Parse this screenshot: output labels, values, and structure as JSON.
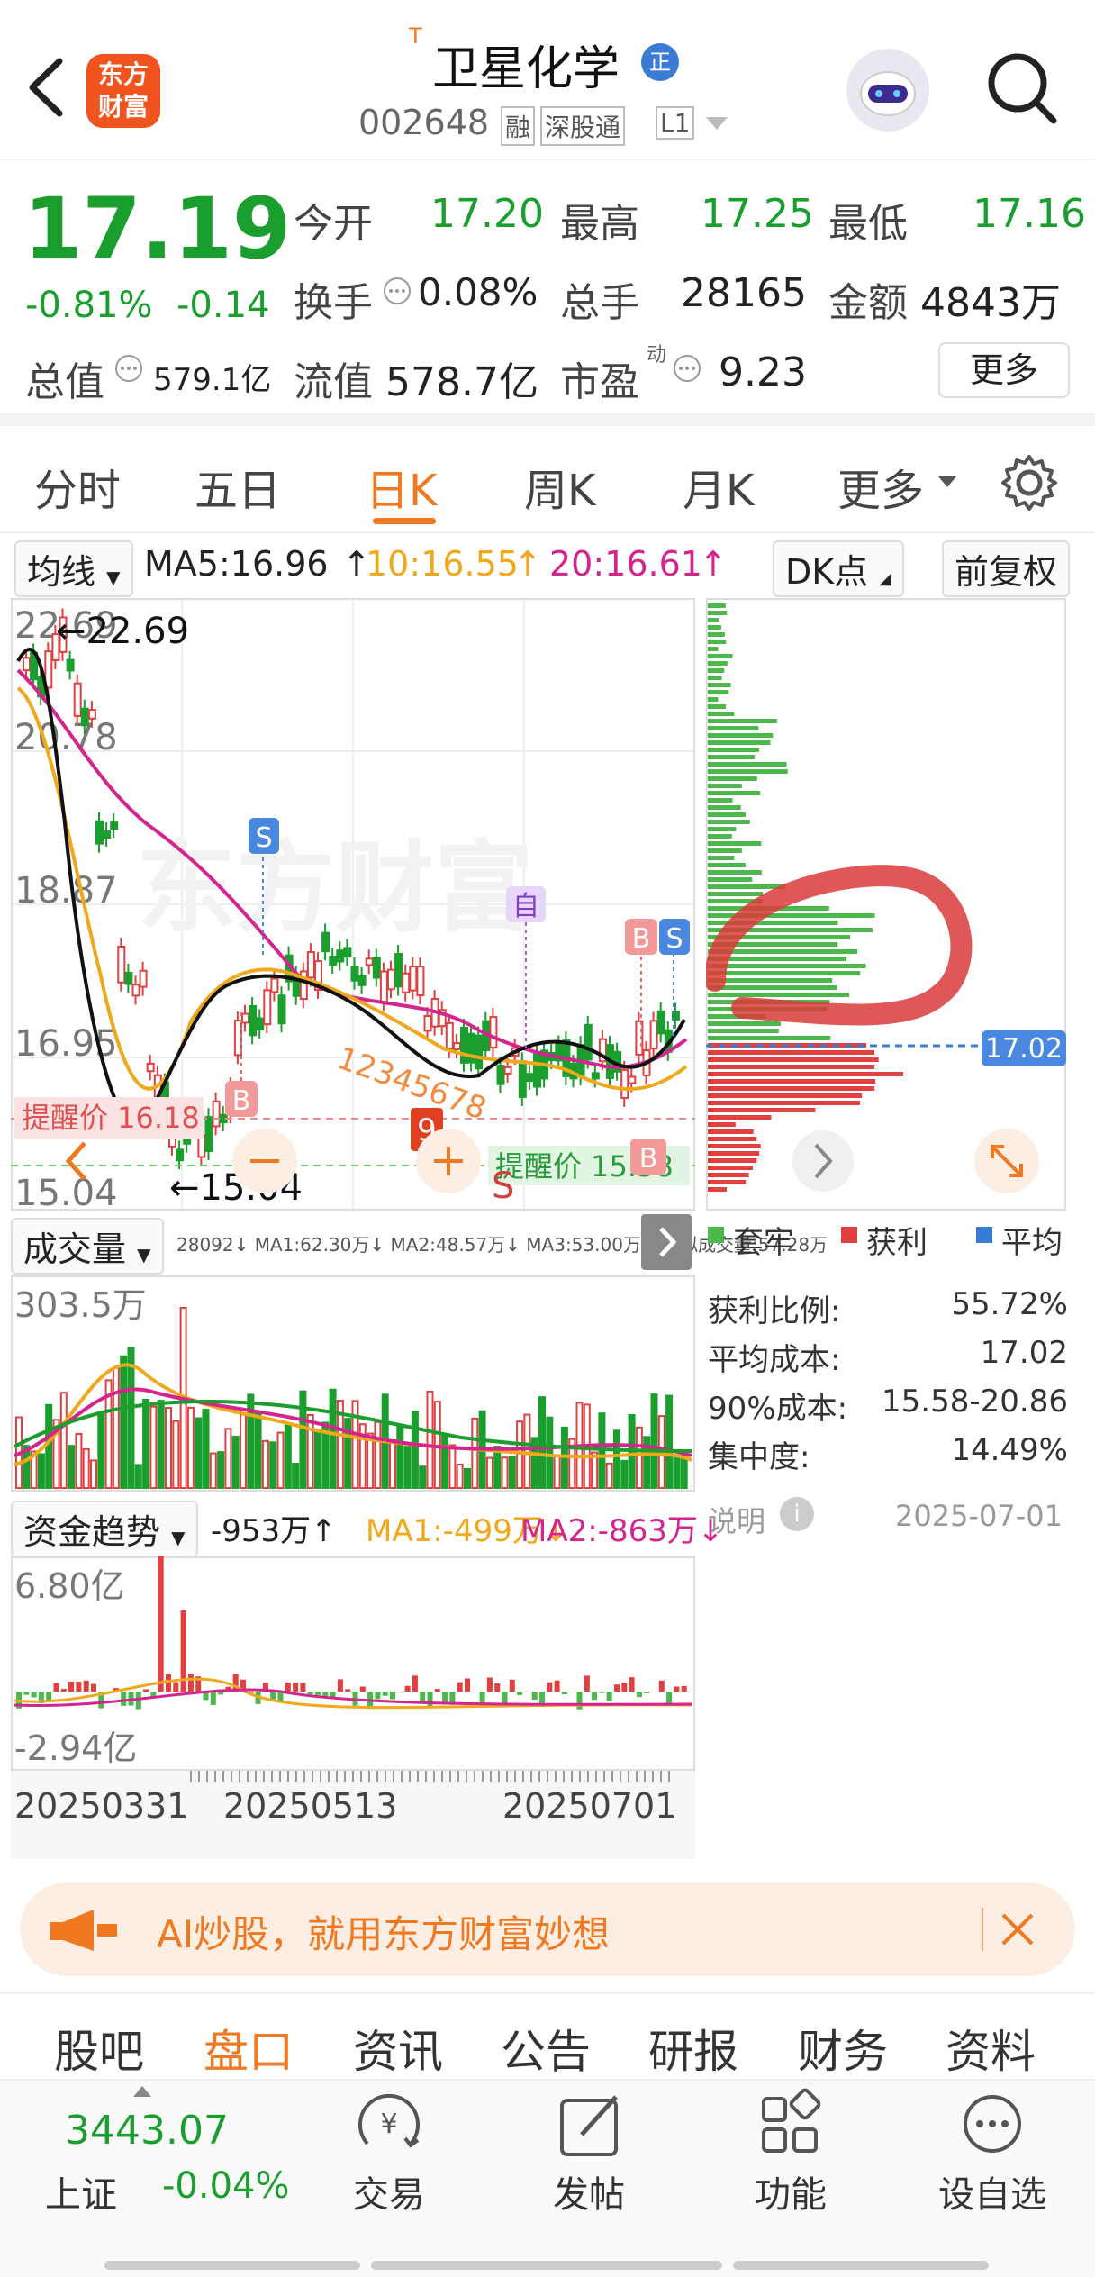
{
  "header": {
    "title": "卫星化学",
    "title_prefix": "T",
    "badge": "正",
    "code": "002648",
    "tags": [
      "融",
      "深股通",
      "L1"
    ],
    "logo": "东方财富"
  },
  "quote": {
    "price": "17.19",
    "change_pct": "-0.81%",
    "change": "-0.14",
    "fields": [
      {
        "label": "今开",
        "value": "17.20"
      },
      {
        "label": "最高",
        "value": "17.25"
      },
      {
        "label": "最低",
        "value": "17.16"
      },
      {
        "label": "换手",
        "value": "0.08%"
      },
      {
        "label": "总手",
        "value": "28165"
      },
      {
        "label": "金额",
        "value": "4843万"
      },
      {
        "label": "总值",
        "value": "579.1亿"
      },
      {
        "label": "流值",
        "value": "578.7亿"
      },
      {
        "label": "市盈",
        "value": "9.23",
        "sup": "动"
      }
    ],
    "more": "更多"
  },
  "tabs": [
    "分时",
    "五日",
    "日K",
    "周K",
    "月K",
    "更多"
  ],
  "active_tab": "日K",
  "ma_bar": {
    "selector": "均线",
    "ma5": "MA5:16.96",
    "ma10": "10:16.55",
    "ma20": "20:16.61",
    "dk": "DK点",
    "adjust": "前复权",
    "colors": {
      "ma5": "#222222",
      "ma10": "#f0a81c",
      "ma20": "#d4258f"
    }
  },
  "kline": {
    "y_labels": [
      "22.69",
      "20.78",
      "18.87",
      "16.95",
      "15.04"
    ],
    "high_mark": "22.69",
    "low_mark": "15.04",
    "alert_upper": "提醒价 16.18",
    "alert_lower": "提醒价 15.58",
    "watermark": "东方财富",
    "signals": [
      "S",
      "B",
      "自",
      "B",
      "S",
      "B",
      "S"
    ],
    "sequence": "12345678",
    "sequence_end": "9"
  },
  "chart_data": {
    "type": "line",
    "title": "",
    "categories": [
      "20250331",
      "20250513",
      "20250701"
    ],
    "series": [
      {
        "name": "MA5",
        "values": [
          16.96
        ]
      },
      {
        "name": "MA10",
        "values": [
          16.55
        ]
      },
      {
        "name": "MA20",
        "values": [
          16.61
        ]
      }
    ],
    "ylim": [
      15.04,
      22.69
    ],
    "yticks": [
      22.69,
      20.78,
      18.87,
      16.95,
      15.04
    ]
  },
  "volume": {
    "selector": "成交量",
    "info": "28092↓ MA1:62.30万↓ MA2:48.57万↓ MA3:53.00万↓ 虚拟成交量:57.28万",
    "max_label": "303.5万"
  },
  "fund": {
    "selector": "资金趋势",
    "value": "-953万↑",
    "ma1": "MA1:-499万↓",
    "ma2": "MA2:-863万↓",
    "max_label": "6.80亿",
    "min_label": "-2.94亿",
    "dates": [
      "20250331",
      "20250513",
      "20250701"
    ]
  },
  "chips": {
    "avg_tag": "17.02",
    "legend": [
      "套牢",
      "获利",
      "平均"
    ],
    "legend_colors": [
      "#4cb84c",
      "#e04040",
      "#3a7bd5"
    ],
    "rows": [
      {
        "label": "获利比例:",
        "value": "55.72%"
      },
      {
        "label": "平均成本:",
        "value": "17.02"
      },
      {
        "label": "90%成本:",
        "value": "15.58-20.86"
      },
      {
        "label": "集中度:",
        "value": "14.49%"
      }
    ],
    "note": "说明",
    "date": "2025-07-01"
  },
  "banner": {
    "text": "AI炒股，就用东方财富妙想"
  },
  "bottom_tabs": [
    "股吧",
    "盘口",
    "资讯",
    "公告",
    "研报",
    "财务",
    "资料"
  ],
  "active_bottom_tab": "盘口",
  "bottom_bar": {
    "index_value": "3443.07",
    "index_name": "上证",
    "index_change": "-0.04%",
    "items": [
      "交易",
      "发帖",
      "功能",
      "设自选"
    ]
  }
}
